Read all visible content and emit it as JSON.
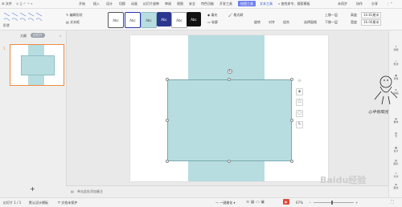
{
  "menubar": {
    "file_label": "文件",
    "items": [
      "开始",
      "插入",
      "设计",
      "切换",
      "动画",
      "幻灯片放映",
      "审阅",
      "视图",
      "安全",
      "特色功能",
      "开发工具"
    ],
    "active_tab": "绘图工具",
    "ribbon_tab": "文本工具",
    "search_label": "查找命令、搜索模板",
    "right_items": [
      "未同步",
      "协作",
      "分享"
    ]
  },
  "ribbon": {
    "fill_label": "填充",
    "outline_label": "轮廓",
    "format_brush_label": "格式刷",
    "rotate_label": "旋转",
    "align_label": "对齐",
    "group_label": "组合",
    "select_pane_label": "选择窗格",
    "up_label": "上移一层",
    "down_label": "下移一层",
    "height_label": "高度",
    "height_value": "10.81厘米",
    "width_label": "宽度",
    "width_value": "16.00厘米",
    "edit_shape_label": "编辑形状",
    "textbox_label": "文本框",
    "shape_label": "形状",
    "abc": "Abc"
  },
  "left_panel": {
    "tab_outline": "大纲",
    "tab_slides": "幻灯片",
    "slide_number": "1",
    "add_button": "+"
  },
  "right_sidebar": [
    "智能",
    "形状",
    "对象",
    "动画",
    "重命",
    "节",
    "设计",
    "图片",
    "分享",
    "美化",
    "帮助"
  ],
  "notes_placeholder": "单击此处添加备注",
  "statusbar": {
    "slide_info": "幻灯片 1 / 1",
    "theme": "默认设计模板",
    "doc_protect": "文档未保护",
    "beautify": "一键美化",
    "zoom": "67%"
  },
  "watermark_text": "心中有阳光",
  "watermark_site": "Baidu经验",
  "colors": {
    "accent": "#6f7ff0",
    "shape_fill": "#b7dde0",
    "shape_border": "#8fbfc4",
    "thumb_border": "#f08a40"
  }
}
